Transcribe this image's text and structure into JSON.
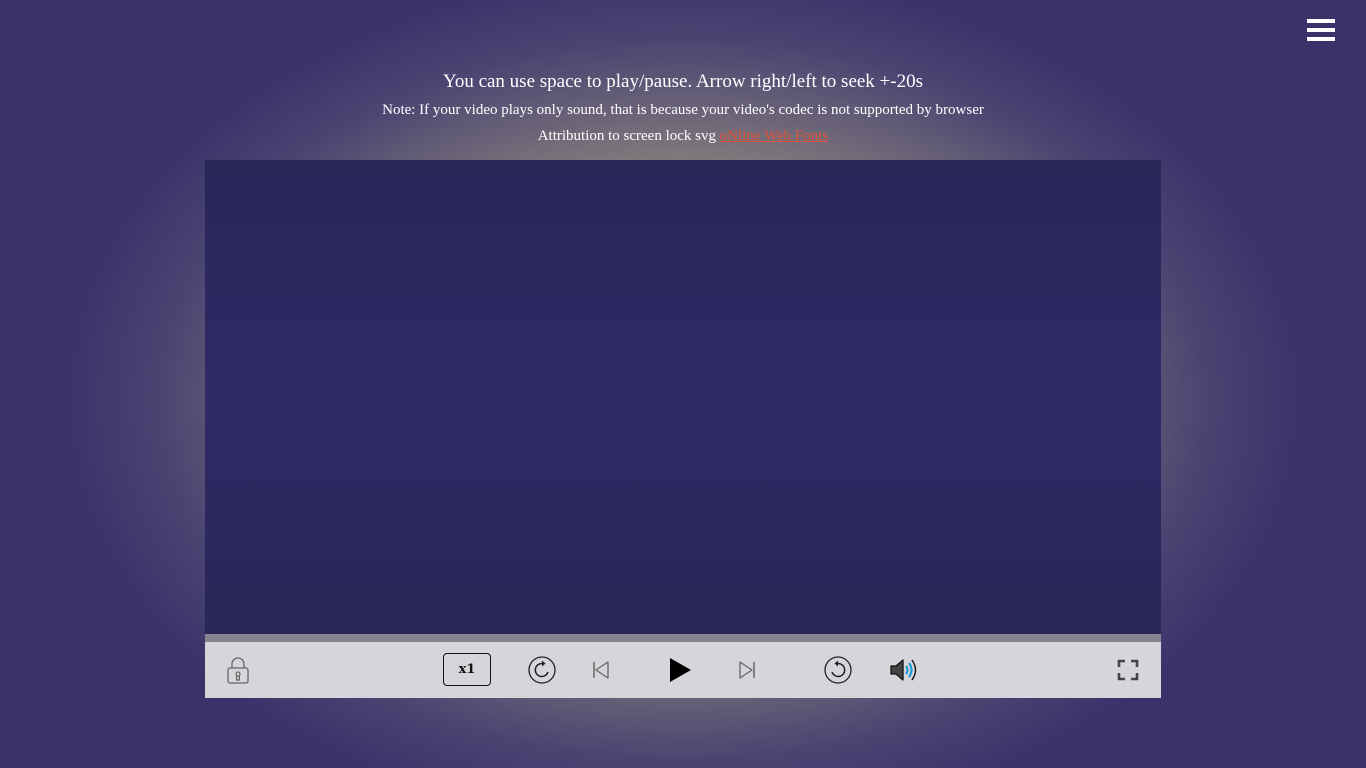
{
  "header": {
    "instructions": "You can use space to play/pause. Arrow right/left to seek +-20s",
    "note": "Note: If your video plays only sound, that is because your video's codec is not supported by browser",
    "attribution_prefix": "Attribution to screen lock svg",
    "attribution_link": "oNline Web Fonts"
  },
  "menu": {
    "icon": "hamburger-menu-icon"
  },
  "controls": {
    "speed_label": "x1",
    "icons": {
      "lock": "lock-icon",
      "rewind": "rewind-icon",
      "previous": "skip-previous-icon",
      "play": "play-icon",
      "next": "skip-next-icon",
      "forward": "forward-icon",
      "volume": "volume-icon",
      "fullscreen": "fullscreen-icon"
    }
  },
  "colors": {
    "link": "#e0533a",
    "video_background": "#2f2a67",
    "controls_background": "#d6d5d9",
    "volume_accent": "#1e9ad6"
  }
}
